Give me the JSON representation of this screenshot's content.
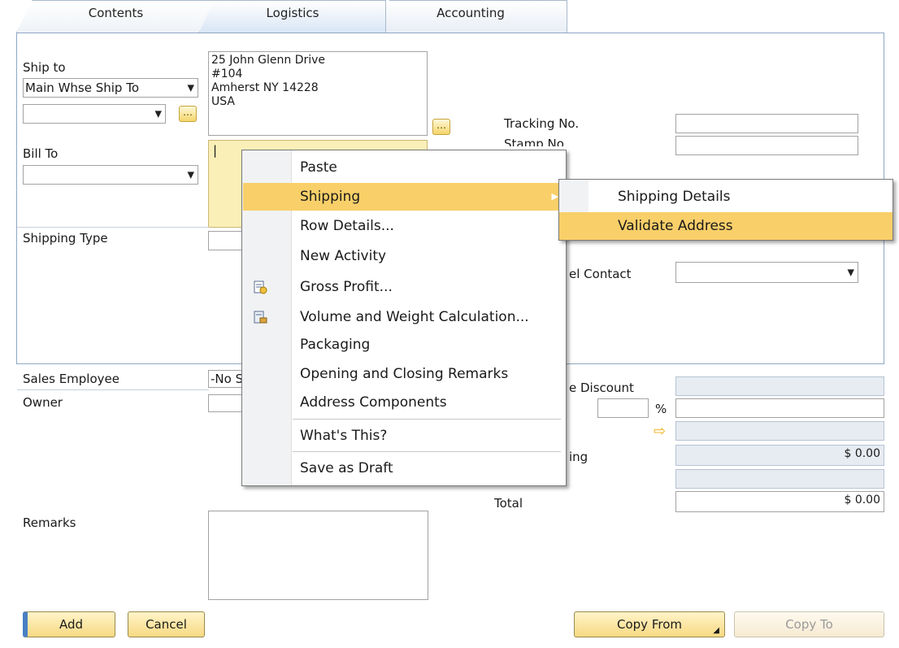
{
  "tabs": [
    {
      "label": "Contents"
    },
    {
      "label": "Logistics"
    },
    {
      "label": "Accounting"
    }
  ],
  "logistics": {
    "ship_to_label": "Ship to",
    "ship_to_select": "Main Whse Ship To",
    "ship_to_address": [
      "25 John Glenn Drive",
      "#104",
      "Amherst NY  14228",
      "USA"
    ],
    "bill_to_label": "Bill To",
    "shipping_type_label": "Shipping Type",
    "tracking_no_label": "Tracking No.",
    "stamp_no_label": "Stamp No.",
    "bp_channel_contact_label": "el Contact"
  },
  "footer": {
    "sales_employee_label": "Sales Employee",
    "sales_employee_value": "-No S",
    "owner_label": "Owner",
    "discount_label": "e Discount",
    "percent_sign": "%",
    "freight_label": "ing",
    "freight_value": "$ 0.00",
    "total_label": "Total",
    "total_value": "$ 0.00",
    "remarks_label": "Remarks"
  },
  "buttons": {
    "add": "Add",
    "cancel": "Cancel",
    "copy_from": "Copy From",
    "copy_to": "Copy To"
  },
  "context_menu": {
    "items": [
      {
        "label": "Paste"
      },
      {
        "label": "Shipping"
      },
      {
        "label": "Row Details..."
      },
      {
        "label": "New Activity"
      },
      {
        "label": "Gross Profit..."
      },
      {
        "label": "Volume and Weight Calculation..."
      },
      {
        "label": "Packaging"
      },
      {
        "label": "Opening and Closing Remarks"
      },
      {
        "label": "Address Components"
      },
      {
        "label": "What's This?"
      },
      {
        "label": "Save as Draft"
      }
    ],
    "highlight_color": "#f9cf69"
  },
  "submenu": {
    "items": [
      {
        "label": "Shipping Details"
      },
      {
        "label": "Validate Address"
      }
    ]
  }
}
